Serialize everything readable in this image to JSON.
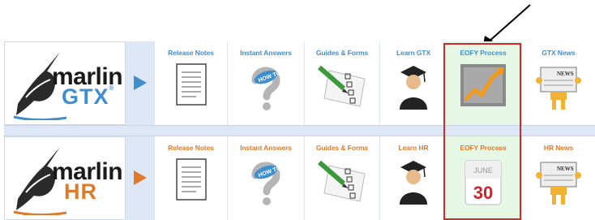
{
  "rows": [
    {
      "id": "gtx",
      "brand": "marlin",
      "product": "GTX",
      "registered": "®",
      "accent": "#3f8fcf",
      "tiles": [
        "Release Notes",
        "Instant Answers",
        "Guides & Forms",
        "Learn GTX",
        "EOFY Process",
        "GTX News"
      ]
    },
    {
      "id": "hr",
      "brand": "marlin",
      "product": "HR",
      "registered": "",
      "accent": "#e07a2b",
      "tiles": [
        "Release Notes",
        "Instant Answers",
        "Guides & Forms",
        "Learn HR",
        "EOFY Process",
        "HR News"
      ]
    }
  ],
  "icons": {
    "question": "HOW TO",
    "news": "NEWS",
    "calendar_month": "JUNE",
    "calendar_day": "30"
  },
  "highlight_color": "#d22a2a"
}
